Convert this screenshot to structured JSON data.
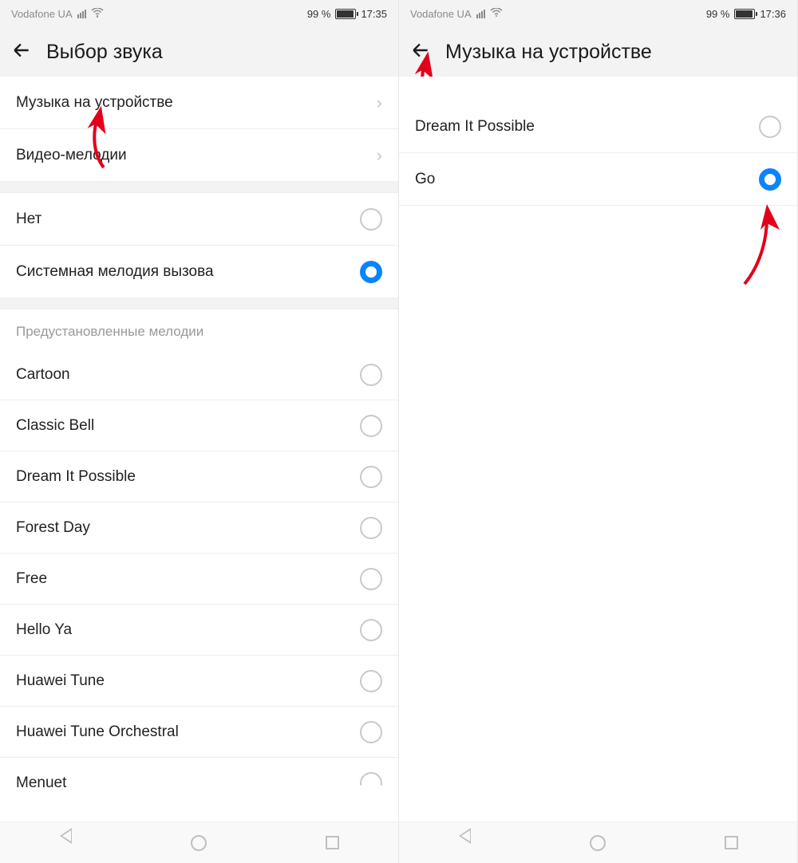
{
  "left": {
    "status": {
      "carrier": "Vodafone UA",
      "battery_pct": "99 %",
      "time": "17:35"
    },
    "header": {
      "title": "Выбор звука"
    },
    "nav_rows": [
      {
        "label": "Музыка на устройстве"
      },
      {
        "label": "Видео-мелодии"
      }
    ],
    "sound_rows": [
      {
        "label": "Нет",
        "selected": false
      },
      {
        "label": "Системная мелодия вызова",
        "selected": true
      }
    ],
    "preset_title": "Предустановленные мелодии",
    "preset_rows": [
      {
        "label": "Cartoon"
      },
      {
        "label": "Classic Bell"
      },
      {
        "label": "Dream It Possible"
      },
      {
        "label": "Forest Day"
      },
      {
        "label": "Free"
      },
      {
        "label": "Hello Ya"
      },
      {
        "label": "Huawei Tune"
      },
      {
        "label": "Huawei Tune Orchestral"
      },
      {
        "label": "Menuet"
      }
    ]
  },
  "right": {
    "status": {
      "carrier": "Vodafone UA",
      "battery_pct": "99 %",
      "time": "17:36"
    },
    "header": {
      "title": "Музыка на устройстве"
    },
    "music_rows": [
      {
        "label": "Dream It Possible",
        "selected": false
      },
      {
        "label": "Go",
        "selected": true
      }
    ]
  }
}
